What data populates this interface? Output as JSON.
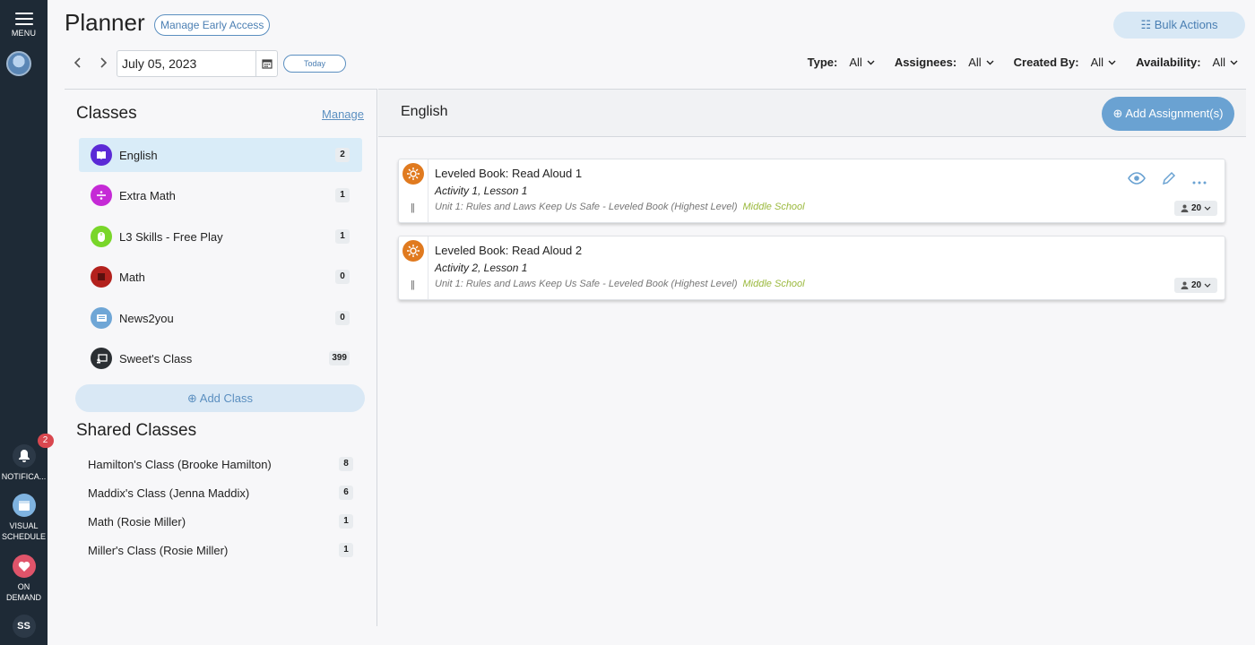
{
  "rail": {
    "menu_label": "MENU",
    "notifications_label": "NOTIFICA...",
    "notifications_count": "2",
    "visual_schedule_label_1": "VISUAL",
    "visual_schedule_label_2": "SCHEDULE",
    "on_demand_label_1": "ON",
    "on_demand_label_2": "DEMAND",
    "user_initials": "SS"
  },
  "header": {
    "title": "Planner",
    "early_access": "Manage Early Access",
    "bulk_actions": "Bulk Actions",
    "date": "July 05, 2023",
    "today": "Today",
    "filters": [
      {
        "key": "Type:",
        "value": "All"
      },
      {
        "key": "Assignees:",
        "value": "All"
      },
      {
        "key": "Created By:",
        "value": "All"
      },
      {
        "key": "Availability:",
        "value": "All"
      }
    ]
  },
  "classes": {
    "heading": "Classes",
    "manage": "Manage",
    "items": [
      {
        "name": "English",
        "count": "2",
        "color": "#5b2ad6"
      },
      {
        "name": "Extra Math",
        "count": "1",
        "color": "#c52ad6"
      },
      {
        "name": "L3 Skills - Free Play",
        "count": "1",
        "color": "#79d62a"
      },
      {
        "name": "Math",
        "count": "0",
        "color": "#b3211d"
      },
      {
        "name": "News2you",
        "count": "0",
        "color": "#6fa6d6"
      },
      {
        "name": "Sweet's Class",
        "count": "399",
        "color": "#2b2f33"
      }
    ],
    "add_class": "Add Class"
  },
  "shared": {
    "heading": "Shared Classes",
    "items": [
      {
        "name": "Hamilton's Class (Brooke Hamilton)",
        "count": "8"
      },
      {
        "name": "Maddix's Class (Jenna Maddix)",
        "count": "6"
      },
      {
        "name": "Math (Rosie Miller)",
        "count": "1"
      },
      {
        "name": "Miller's Class (Rosie Miller)",
        "count": "1"
      }
    ]
  },
  "main": {
    "title": "English",
    "add_assignments": "Add Assignment(s)",
    "cards": [
      {
        "title": "Leveled Book: Read Aloud 1",
        "subtitle": "Activity 1, Lesson 1",
        "unit": "Unit 1: Rules and Laws Keep Us Safe - Leveled Book (Highest Level)",
        "level": "Middle School",
        "assignees": "20"
      },
      {
        "title": "Leveled Book: Read Aloud 2",
        "subtitle": "Activity 2, Lesson 1",
        "unit": "Unit 1: Rules and Laws Keep Us Safe - Leveled Book (Highest Level)",
        "level": "Middle School",
        "assignees": "20"
      }
    ]
  }
}
